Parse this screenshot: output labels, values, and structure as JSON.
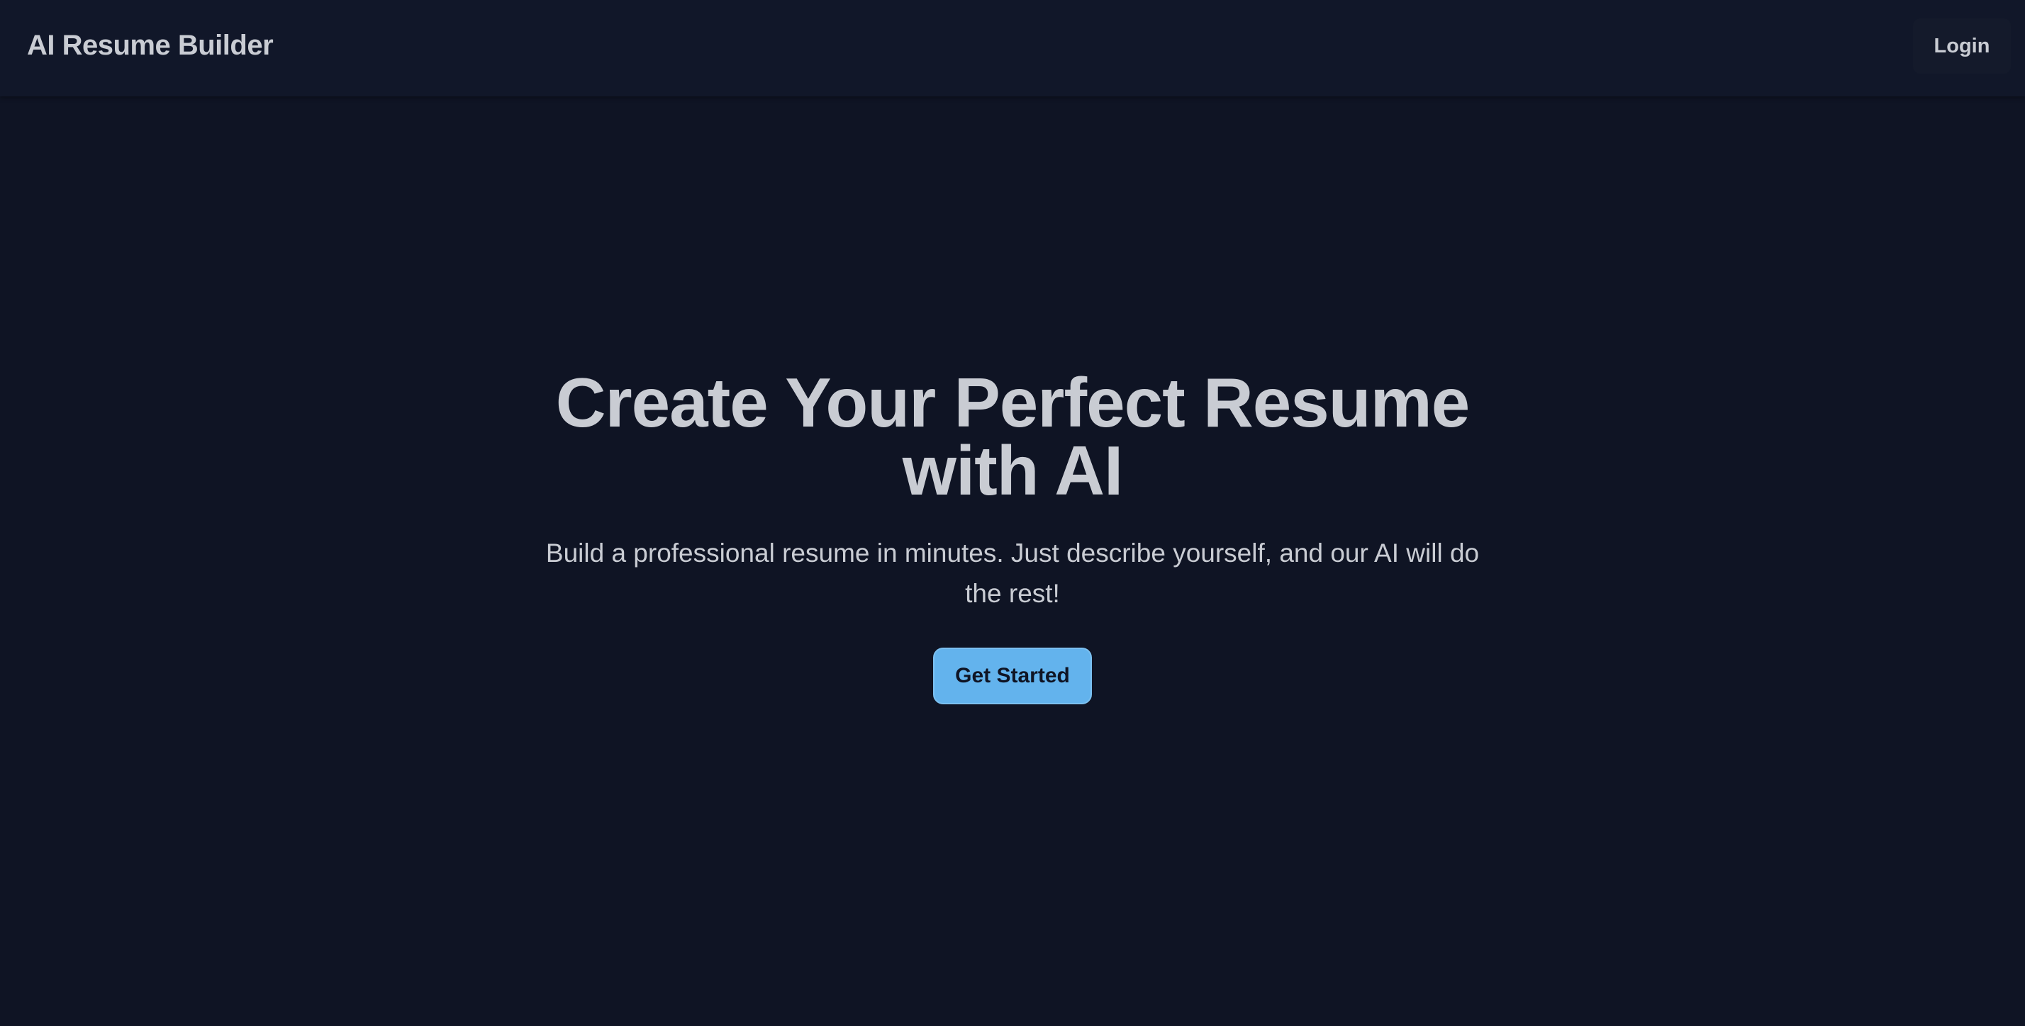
{
  "navbar": {
    "brand": "AI Resume Builder",
    "login_label": "Login"
  },
  "hero": {
    "title": "Create Your Perfect Resume with AI",
    "subtitle": "Build a professional resume in minutes. Just describe yourself, and our AI will do the rest!",
    "cta_label": "Get Started"
  },
  "colors": {
    "background": "#0f1424",
    "navbar": "#111729",
    "text": "#c9ccd3",
    "accent": "#63b3ed"
  }
}
